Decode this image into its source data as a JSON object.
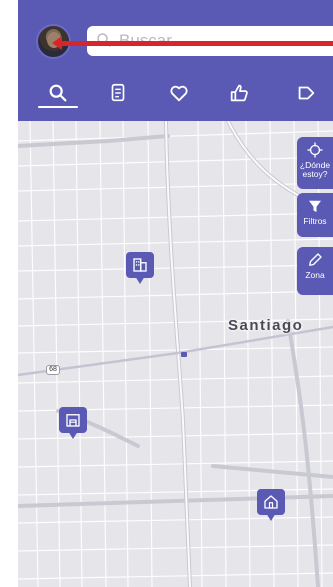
{
  "search": {
    "placeholder": "Buscar"
  },
  "tabs": [
    {
      "icon": "search-icon",
      "active": true
    },
    {
      "icon": "receipt-icon"
    },
    {
      "icon": "heart-icon"
    },
    {
      "icon": "thumbs-up-icon"
    },
    {
      "icon": "tag-icon"
    }
  ],
  "map": {
    "city_label": "Santiago",
    "route_shield": "68",
    "pins": [
      {
        "icon": "building-icon"
      },
      {
        "icon": "warehouse-icon"
      },
      {
        "icon": "house-icon"
      }
    ]
  },
  "side_buttons": {
    "locate": {
      "label_line1": "¿Dónde",
      "label_line2": "estoy?"
    },
    "filters": {
      "label": "Filtros"
    },
    "zone": {
      "label": "Zona"
    }
  },
  "colors": {
    "brand": "#5a5ab5",
    "annotation": "#d9252a",
    "map_bg": "#e5e5ea"
  }
}
